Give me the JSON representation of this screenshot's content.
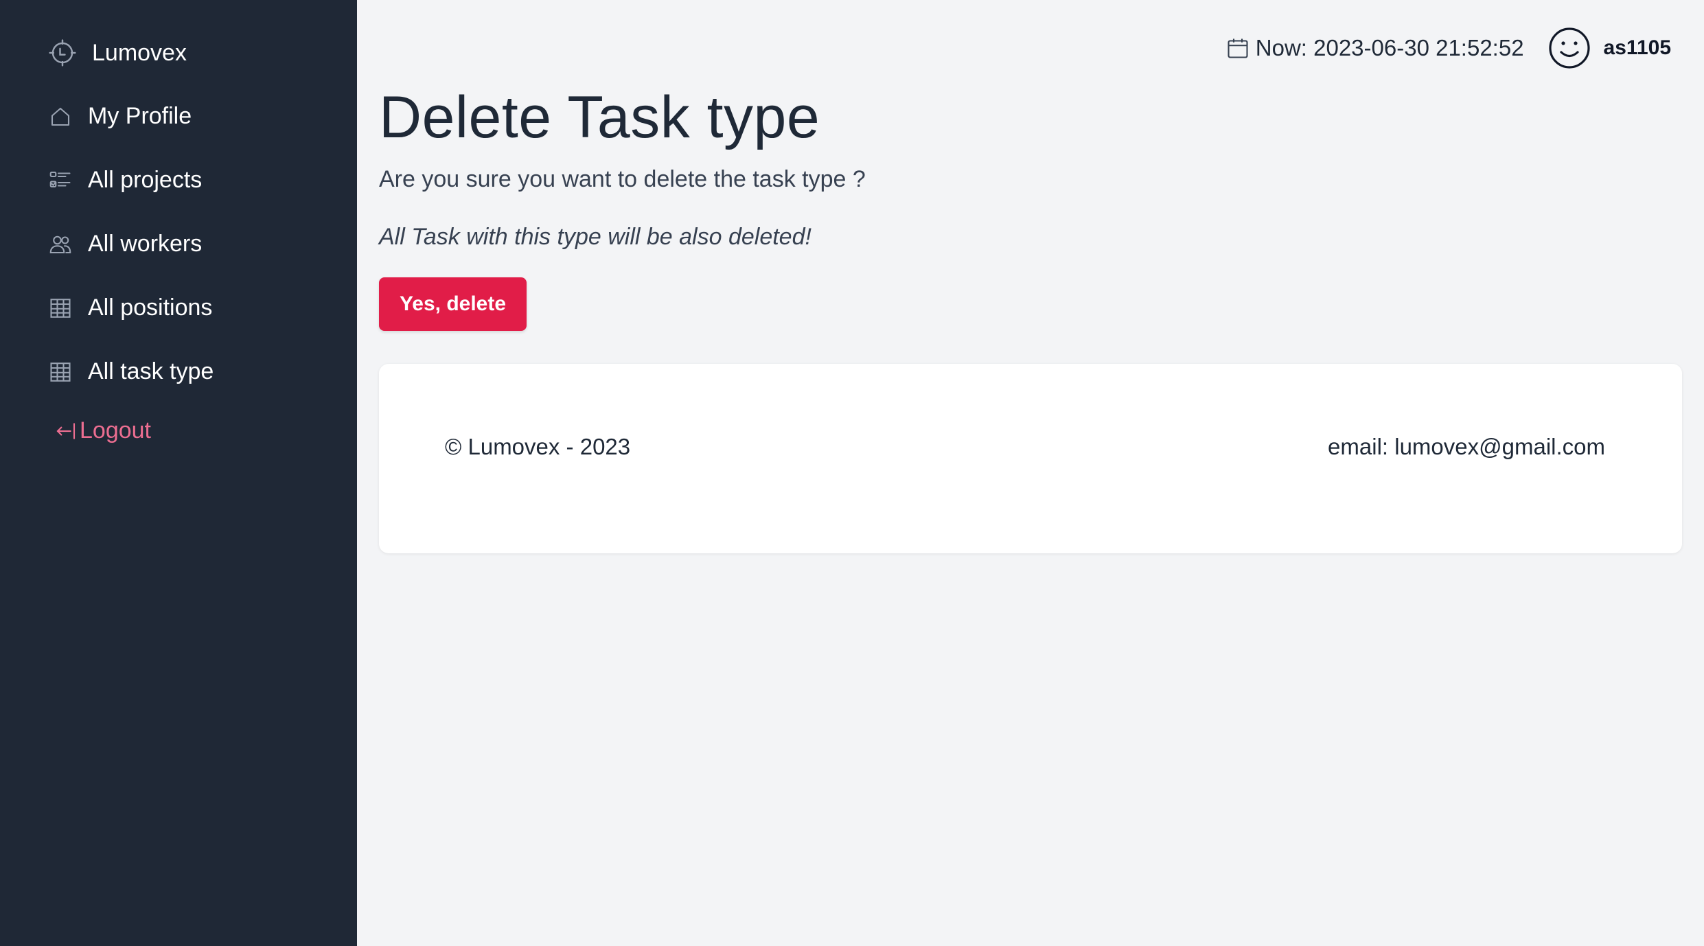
{
  "sidebar": {
    "brand": {
      "name": "Lumovex",
      "icon": "crosshair-clock-icon"
    },
    "items": [
      {
        "label": "My Profile",
        "icon": "home-icon"
      },
      {
        "label": "All projects",
        "icon": "checklist-icon"
      },
      {
        "label": "All workers",
        "icon": "users-icon"
      },
      {
        "label": "All positions",
        "icon": "table-icon"
      },
      {
        "label": "All task type",
        "icon": "table-icon"
      }
    ],
    "logout": {
      "label": "Logout",
      "icon": "logout-arrow-icon",
      "color": "#ec6e91"
    }
  },
  "topbar": {
    "clock": "Now: 2023-06-30 21:52:52",
    "clock_icon": "calendar-icon",
    "username": "as1105",
    "avatar_icon": "smiley-icon"
  },
  "main": {
    "title": "Delete Task type",
    "question": "Are you sure you want to delete the task type ?",
    "warning": "All Task with this type will be also deleted!",
    "delete_button": "Yes, delete"
  },
  "footer": {
    "copyright": "© Lumovex - 2023",
    "email": "email: lumovex@gmail.com"
  },
  "colors": {
    "sidebar_bg": "#1f2836",
    "page_bg": "#f3f4f6",
    "danger": "#e11d48",
    "logout": "#ec6e91"
  }
}
